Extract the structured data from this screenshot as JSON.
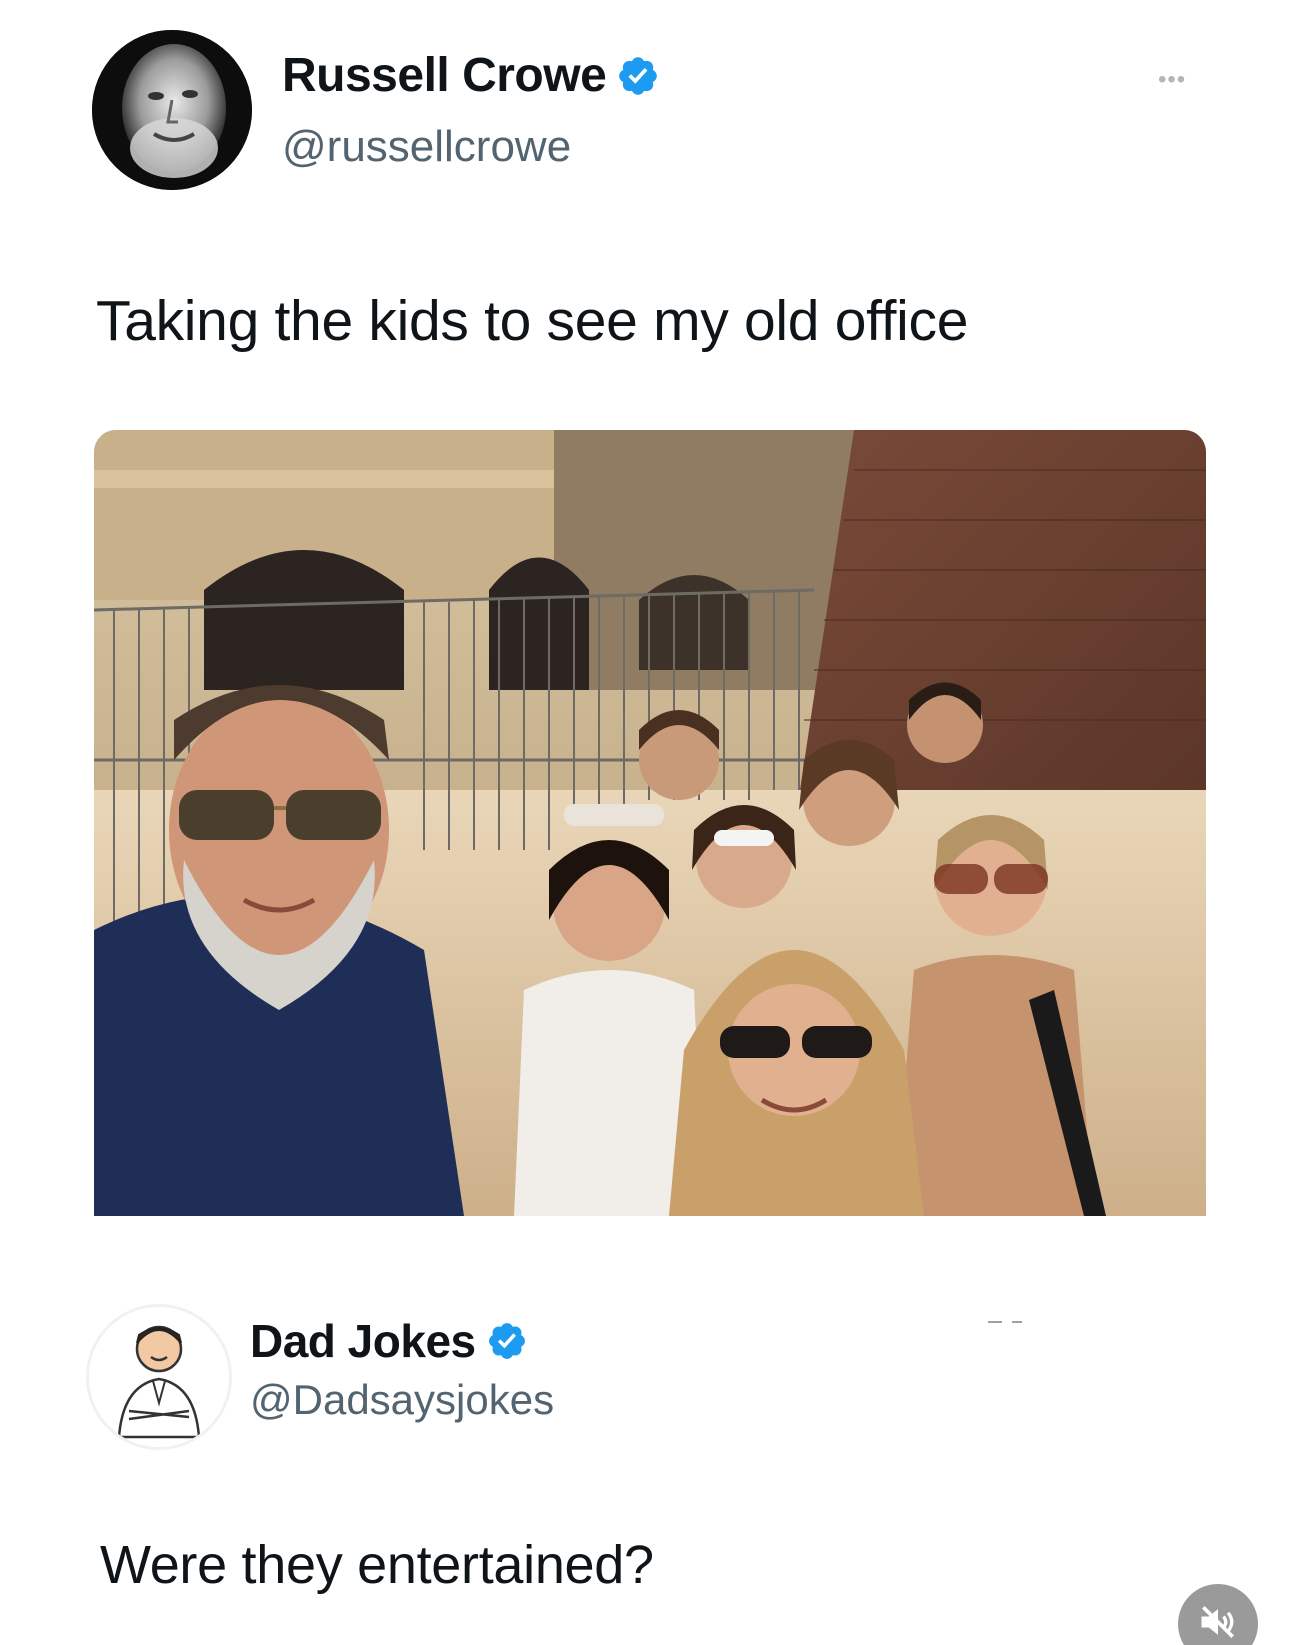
{
  "tweets": [
    {
      "display_name": "Russell Crowe",
      "handle": "@russellcrowe",
      "text": "Taking the kids to see my old office",
      "verified": true,
      "more_label": "•••"
    },
    {
      "display_name": "Dad Jokes",
      "handle": "@Dadsaysjokes",
      "text": "Were they entertained?",
      "verified": true
    }
  ],
  "icons": {
    "verified": "verified-badge-icon",
    "more": "more-options-icon",
    "mute": "speaker-muted-icon"
  },
  "colors": {
    "verified_blue": "#1d9bf0",
    "handle_gray": "#536471",
    "text_dark": "#0f1419"
  }
}
